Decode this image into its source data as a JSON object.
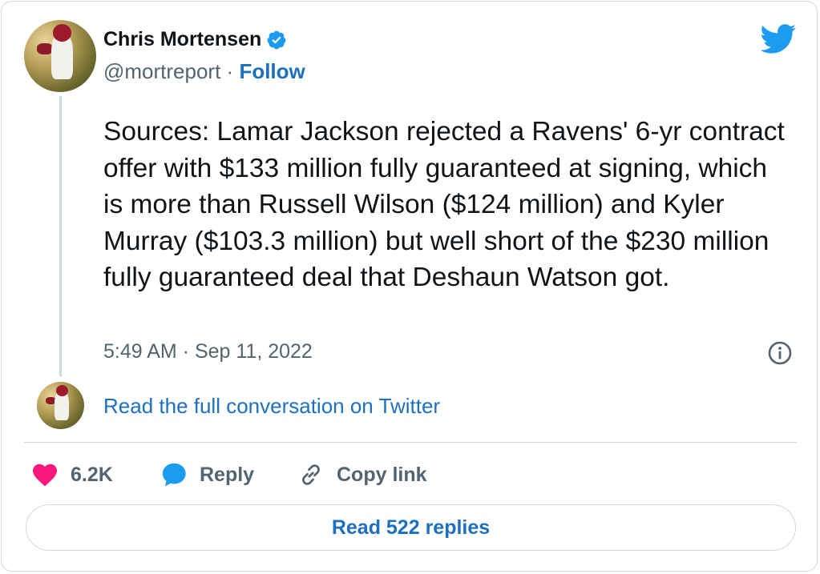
{
  "author": {
    "name": "Chris Mortensen",
    "handle": "@mortreport",
    "separator": " · ",
    "follow_label": "Follow",
    "verified": true
  },
  "tweet": {
    "text": "Sources: Lamar Jackson rejected a Ravens'  6-yr contract offer with $133 million fully guaranteed at signing, which is more than Russell Wilson ($124 million) and Kyler Murray ($103.3 million) but well short of the $230 million fully guaranteed deal that Deshaun Watson got.",
    "timestamp": "5:49 AM · Sep 11, 2022"
  },
  "conversation_link": "Read the full conversation on Twitter",
  "actions": {
    "likes": "6.2K",
    "reply_label": "Reply",
    "copy_label": "Copy link"
  },
  "replies_button": "Read 522 replies",
  "colors": {
    "link": "#1d6fbf",
    "twitter_blue": "#1d9bf0",
    "like_pink": "#f91880",
    "muted": "#536471",
    "border": "#cfd9de"
  },
  "icons": [
    "verified-badge-icon",
    "twitter-bird-icon",
    "info-icon",
    "heart-icon",
    "reply-bubble-icon",
    "link-icon"
  ]
}
